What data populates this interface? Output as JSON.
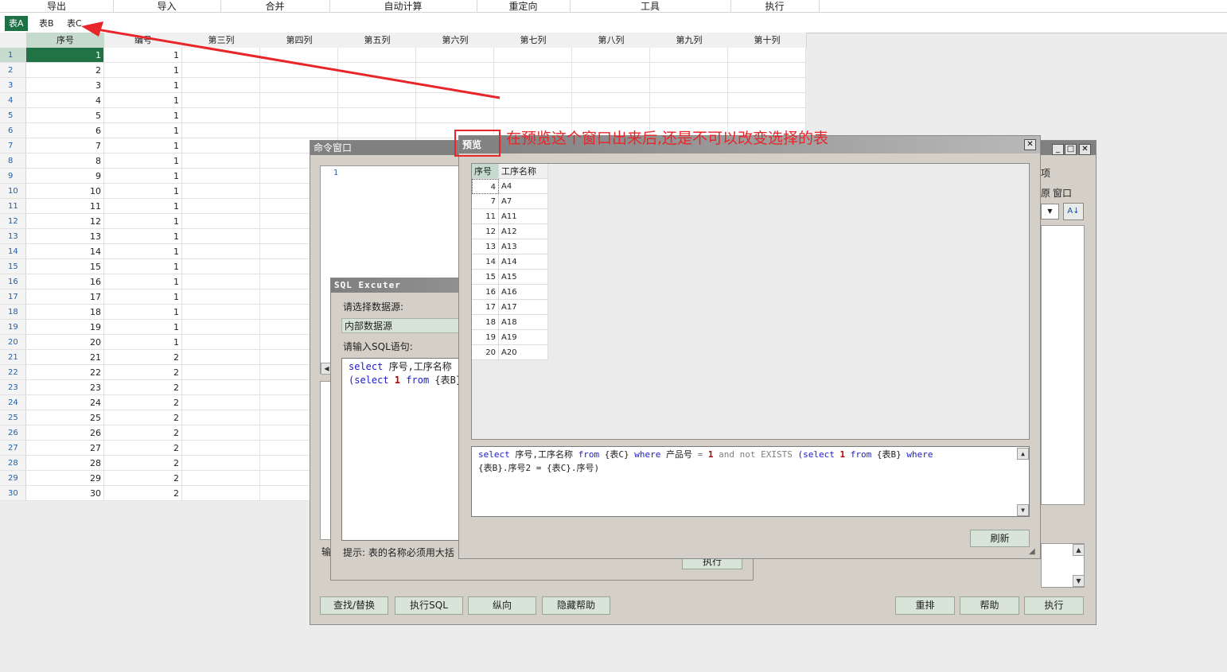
{
  "menu": [
    "导出",
    "导入",
    "合并",
    "自动计算",
    "重定向",
    "工具",
    "执行"
  ],
  "sheets": [
    "表A",
    "表B",
    "表C"
  ],
  "columns": [
    "序号",
    "编号",
    "第三列",
    "第四列",
    "第五列",
    "第六列",
    "第七列",
    "第八列",
    "第九列",
    "第十列"
  ],
  "rows": [
    [
      "1",
      "1"
    ],
    [
      "2",
      "1"
    ],
    [
      "3",
      "1"
    ],
    [
      "4",
      "1"
    ],
    [
      "5",
      "1"
    ],
    [
      "6",
      "1"
    ],
    [
      "7",
      "1"
    ],
    [
      "8",
      "1"
    ],
    [
      "9",
      "1"
    ],
    [
      "10",
      "1"
    ],
    [
      "11",
      "1"
    ],
    [
      "12",
      "1"
    ],
    [
      "13",
      "1"
    ],
    [
      "14",
      "1"
    ],
    [
      "15",
      "1"
    ],
    [
      "16",
      "1"
    ],
    [
      "17",
      "1"
    ],
    [
      "18",
      "1"
    ],
    [
      "19",
      "1"
    ],
    [
      "20",
      "1"
    ],
    [
      "21",
      "2"
    ],
    [
      "22",
      "2"
    ],
    [
      "23",
      "2"
    ],
    [
      "24",
      "2"
    ],
    [
      "25",
      "2"
    ],
    [
      "26",
      "2"
    ],
    [
      "27",
      "2"
    ],
    [
      "28",
      "2"
    ],
    [
      "29",
      "2"
    ],
    [
      "30",
      "2"
    ]
  ],
  "command_window": {
    "title": "命令窗口",
    "line_number": "1",
    "right_labels": {
      "item1": "项",
      "item2": "原",
      "item3": "窗口"
    },
    "buttons": {
      "find_replace": "查找/替换",
      "exec_sql": "执行SQL",
      "vertical": "纵向",
      "hide_help": "隐藏帮助",
      "rearrange": "重排",
      "help": "帮助",
      "execute": "执行"
    }
  },
  "sql_executer": {
    "title": "SQL Excuter",
    "datasource_label": "请选择数据源:",
    "datasource_value": "内部数据源",
    "sql_label": "请输入SQL语句:",
    "sql_line1": {
      "kw": "select",
      "rest": " 序号,工序名称"
    },
    "sql_line2": {
      "pre": "(select ",
      "num": "1",
      "kw": "from",
      "rest": " {表B}"
    },
    "hint": "提示: 表的名称必须用大括",
    "side_label": "输",
    "execute_button": "执行"
  },
  "preview": {
    "title": "预览",
    "columns": [
      "序号",
      "工序名称"
    ],
    "rows": [
      [
        "4",
        "A4"
      ],
      [
        "7",
        "A7"
      ],
      [
        "11",
        "A11"
      ],
      [
        "12",
        "A12"
      ],
      [
        "13",
        "A13"
      ],
      [
        "14",
        "A14"
      ],
      [
        "15",
        "A15"
      ],
      [
        "16",
        "A16"
      ],
      [
        "17",
        "A17"
      ],
      [
        "18",
        "A18"
      ],
      [
        "19",
        "A19"
      ],
      [
        "20",
        "A20"
      ]
    ],
    "sql": {
      "t1": "select",
      "t2": " 序号,工序名称 ",
      "t3": "from",
      "t4": " {表C} ",
      "t5": "where",
      "t6": " 产品号 ",
      "t7": "=",
      "t8": "1",
      "t9": "and not EXISTS",
      "t10": "(select",
      "t11": "1",
      "t12": "from",
      "t13": " {表B} ",
      "t14": "where",
      "t15": "{表B}.序号2 = {表C}.序号)"
    },
    "refresh_button": "刷新"
  },
  "annotation": {
    "text": "在预览这个窗口出来后,还是不可以改变选择的表",
    "color": "#e8262a"
  }
}
